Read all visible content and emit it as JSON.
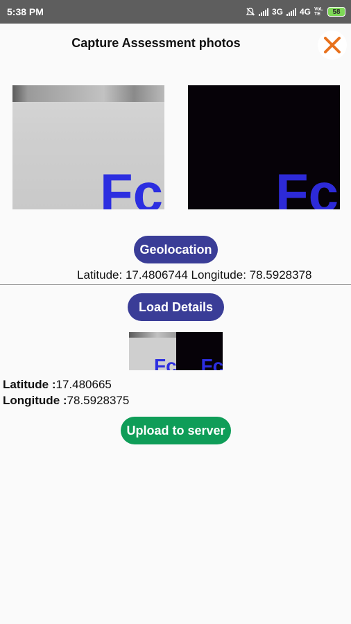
{
  "status_bar": {
    "time": "5:38 PM",
    "network_1": "3G",
    "network_2": "4G",
    "volte": "VoLTE",
    "battery": "58"
  },
  "header": {
    "title": "Capture Assessment photos",
    "close_icon": "close-icon",
    "accent_color": "#e8711c"
  },
  "photos": [
    {
      "name": "photo-1",
      "glyph": "Fc"
    },
    {
      "name": "photo-2",
      "glyph": "Fc"
    }
  ],
  "geolocation": {
    "button_label": "Geolocation",
    "latitude_label": "Latitude:",
    "latitude_value": "17.4806744",
    "longitude_label": "Longitude:",
    "longitude_value": "78.5928378"
  },
  "load_details": {
    "button_label": "Load Details",
    "latitude_label": "Latitude :",
    "latitude_value": "17.480665",
    "longitude_label": "Longitude :",
    "longitude_value": "78.5928375"
  },
  "upload": {
    "button_label": "Upload to server"
  },
  "colors": {
    "primary_button": "#3a3d97",
    "upload_button": "#0f9d58",
    "status_bar": "#5e5e5e"
  }
}
